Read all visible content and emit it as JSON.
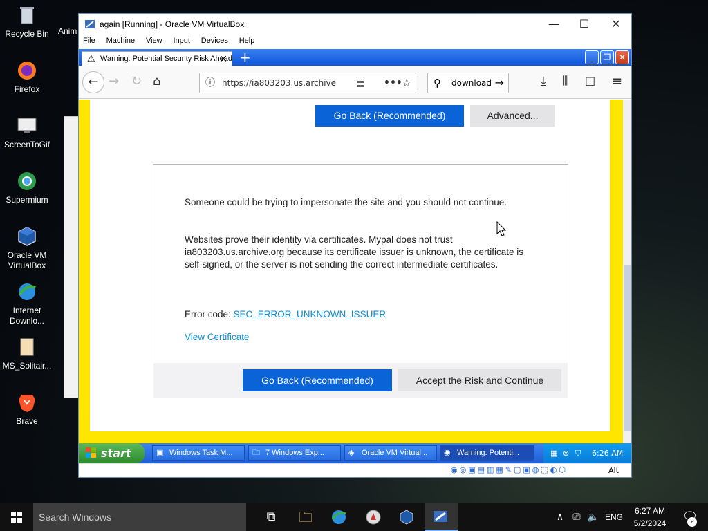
{
  "desktop": {
    "icons": [
      {
        "label": "Recycle Bin",
        "icon": "recycle-bin-icon"
      },
      {
        "label": "Firefox",
        "icon": "firefox-icon"
      },
      {
        "label": "ScreenToGif",
        "icon": "screentogif-icon"
      },
      {
        "label": "Supermium",
        "icon": "supermium-icon"
      },
      {
        "label": "Oracle VM VirtualBox",
        "icon": "virtualbox-icon"
      },
      {
        "label": "Internet Downlo...",
        "icon": "internet-download-manager-icon"
      },
      {
        "label": "MS_Solitair...",
        "icon": "file-icon"
      },
      {
        "label": "Brave",
        "icon": "brave-icon"
      }
    ],
    "partial_label": "Anim"
  },
  "vbox": {
    "title": "again [Running] - Oracle VM VirtualBox",
    "menu": [
      "File",
      "Machine",
      "View",
      "Input",
      "Devices",
      "Help"
    ]
  },
  "firefox": {
    "tab_title": "Warning: Potential Security Risk Ahead",
    "url": "https://ia803203.us.archive",
    "search_text": "download"
  },
  "page": {
    "top_back_label": "Go Back (Recommended)",
    "top_advanced_label": "Advanced...",
    "para1": "Someone could be trying to impersonate the site and you should not continue.",
    "para2": "Websites prove their identity via certificates. Mypal does not trust ia803203.us.archive.org because its certificate issuer is unknown, the certificate is self-signed, or the server is not sending the correct intermediate certificates.",
    "error_prefix": "Error code: ",
    "error_code": "SEC_ERROR_UNKNOWN_ISSUER",
    "view_cert": "View Certificate",
    "go_back_label": "Go Back (Recommended)",
    "accept_label": "Accept the Risk and Continue"
  },
  "xp_taskbar": {
    "start": "start",
    "items": [
      "Windows Task M...",
      "7 Windows Exp...",
      "Oracle VM Virtual...",
      "Warning: Potenti..."
    ],
    "time": "6:26 AM"
  },
  "vbox_status": {
    "key": "Alt"
  },
  "host_taskbar": {
    "search_placeholder": "Search Windows",
    "lang": "ENG",
    "time": "6:27 AM",
    "date": "5/2/2024",
    "notif_count": "2"
  }
}
